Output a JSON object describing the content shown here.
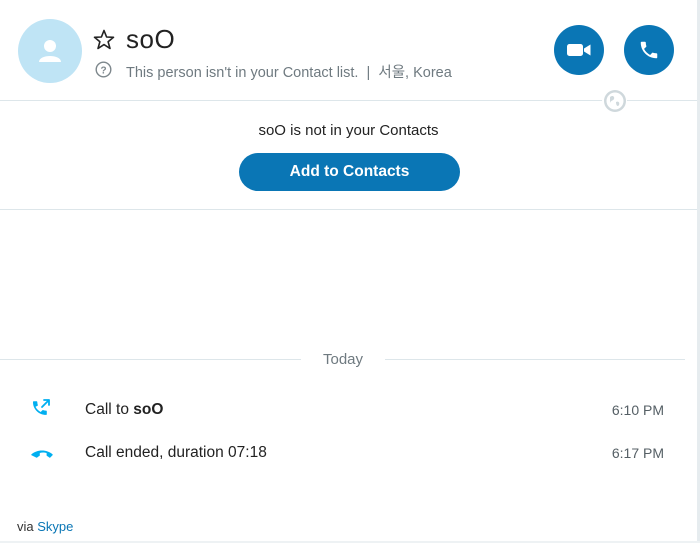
{
  "contact": {
    "name": "soO",
    "status_text": "This person isn't in your Contact list.",
    "separator": "|",
    "location": "서울, Korea"
  },
  "actions": {
    "video_icon": "video-camera-icon",
    "call_icon": "phone-icon",
    "favorite_icon": "star-icon"
  },
  "notice": {
    "message": "soO is not in your Contacts",
    "add_button": "Add to Contacts"
  },
  "conversation": {
    "day_label": "Today",
    "events": [
      {
        "icon": "outgoing-call-icon",
        "prefix": "Call to ",
        "bold": "soO",
        "time": "6:10 PM"
      },
      {
        "icon": "call-ended-icon",
        "prefix": "Call ended, duration 07:18",
        "bold": "",
        "time": "6:17 PM"
      }
    ]
  },
  "footer": {
    "via": "via",
    "link": "Skype"
  },
  "colors": {
    "accent": "#0a76b5",
    "avatar_bg": "#bfe4f5",
    "icon_blue": "#00aff0",
    "muted_text": "#6f7a80"
  }
}
